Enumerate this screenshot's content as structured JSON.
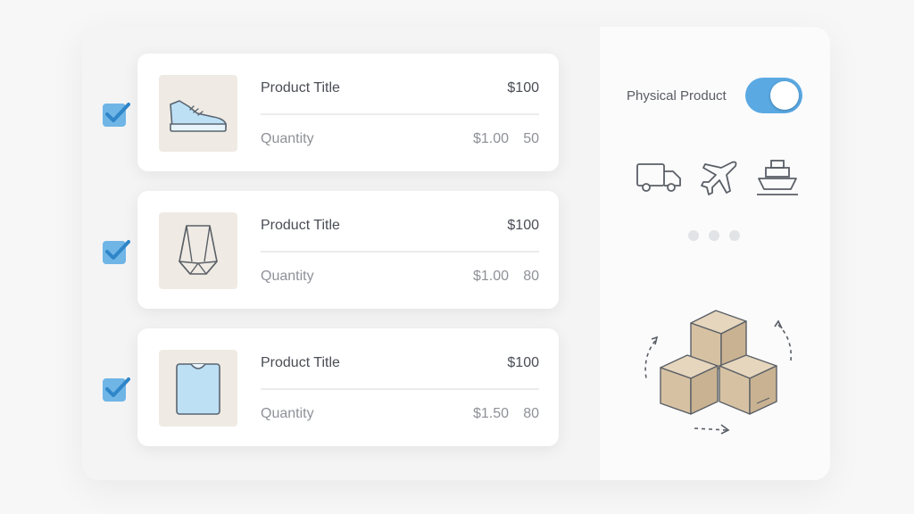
{
  "products": [
    {
      "title": "Product Title",
      "price": "$100",
      "quantity_label": "Quantity",
      "unit_price": "$1.00",
      "quantity": "50",
      "icon": "sneaker-icon",
      "checked": true
    },
    {
      "title": "Product Title",
      "price": "$100",
      "quantity_label": "Quantity",
      "unit_price": "$1.00",
      "quantity": "80",
      "icon": "geometric-bag-icon",
      "checked": true
    },
    {
      "title": "Product Title",
      "price": "$100",
      "quantity_label": "Quantity",
      "unit_price": "$1.50",
      "quantity": "80",
      "icon": "tshirt-icon",
      "checked": true
    }
  ],
  "shipping": {
    "toggle_label": "Physical Product",
    "toggle_on": true,
    "methods": [
      "truck-icon",
      "airplane-icon",
      "ship-icon"
    ],
    "pagination_dots": 3
  },
  "colors": {
    "accent": "#5aa9e3",
    "checkbox": "#5aa9e3",
    "box": "#d9c8ad"
  }
}
